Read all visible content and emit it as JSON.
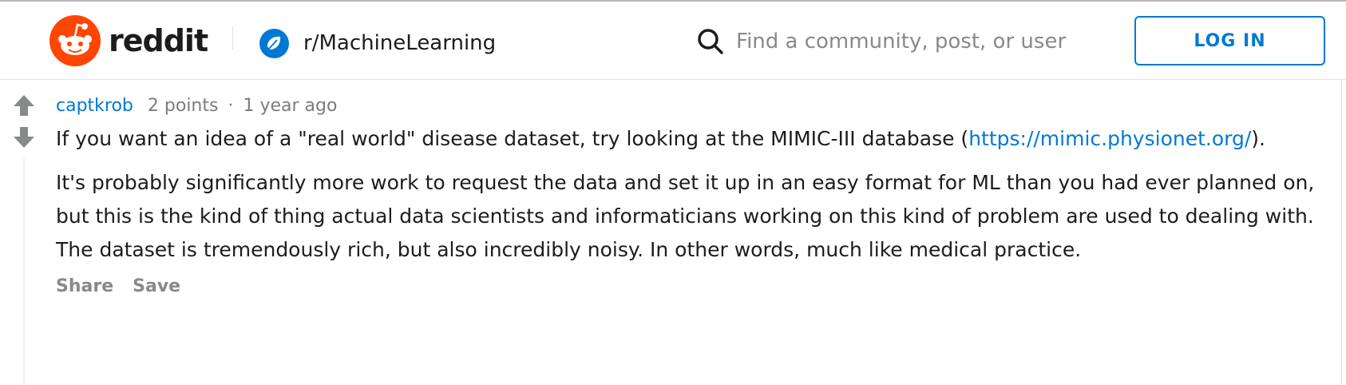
{
  "header": {
    "logo_text": "reddit",
    "community_name": "r/MachineLearning",
    "search_placeholder": "Find a community, post, or user",
    "login_label": "LOG IN"
  },
  "colors": {
    "brand": "#ff4500",
    "link": "#0079d3",
    "muted": "#7c7c7c"
  },
  "icons": {
    "logo": "reddit-snoo-icon",
    "community": "community-icon",
    "search": "search-icon",
    "upvote": "upvote-arrow-icon",
    "downvote": "downvote-arrow-icon"
  },
  "comment": {
    "author": "captkrob",
    "points": "2 points",
    "separator": "·",
    "time": "1 year ago",
    "para1_before": "If you want an idea of a \"real world\" disease dataset, try looking at the MIMIC-III database (",
    "para1_link": "https://mimic.physionet.org/",
    "para1_after": ").",
    "para2": "It's probably significantly more work to request the data and set it up in an easy format for ML than you had ever planned on, but this is the kind of thing actual data scientists and informaticians working on this kind of problem are used to dealing with. The dataset is tremendously rich, but also incredibly noisy. In other words, much like medical practice.",
    "actions": {
      "share": "Share",
      "save": "Save"
    }
  }
}
